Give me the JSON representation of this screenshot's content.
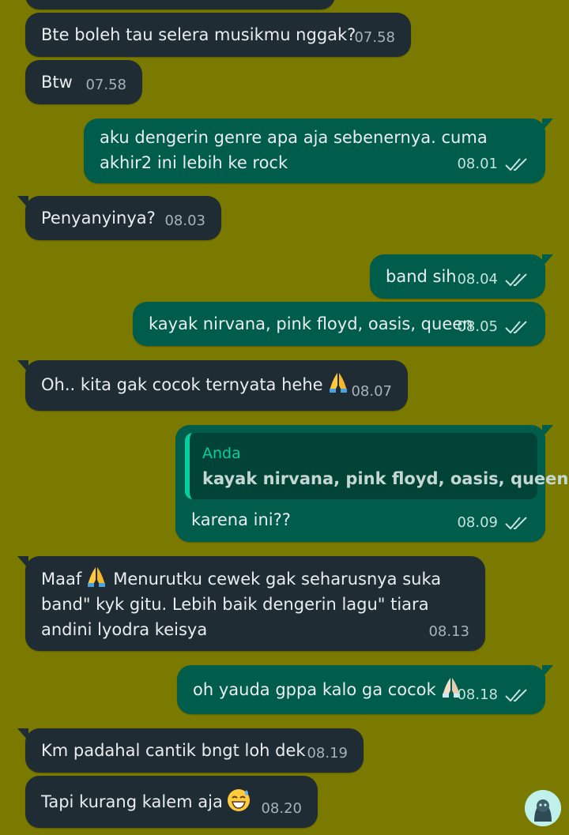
{
  "messages": [
    {
      "id": "m1",
      "dir": "in",
      "text": "Bte boleh tau selera musikmu nggak?",
      "time": "07.58"
    },
    {
      "id": "m2",
      "dir": "in",
      "text": "Btw",
      "time": "07.58"
    },
    {
      "id": "m3",
      "dir": "out",
      "text": "aku dengerin genre apa aja sebenernya. cuma akhir2 ini lebih ke rock",
      "time": "08.01",
      "status": "read"
    },
    {
      "id": "m4",
      "dir": "in",
      "text": "Penyanyinya?",
      "time": "08.03"
    },
    {
      "id": "m5",
      "dir": "out",
      "text": "band sih",
      "time": "08.04",
      "status": "read"
    },
    {
      "id": "m6",
      "dir": "out",
      "text": "kayak nirvana, pink floyd, oasis, queen",
      "time": "08.05",
      "status": "read"
    },
    {
      "id": "m7",
      "dir": "in",
      "text": "Oh.. kita gak cocok ternyata hehe",
      "emoji": "folded-hands",
      "time": "08.07"
    },
    {
      "id": "m8",
      "dir": "out",
      "quote_author": "Anda",
      "quote_text": "kayak nirvana, pink floyd, oasis, queen",
      "text": "karena ini??",
      "time": "08.09",
      "status": "read"
    },
    {
      "id": "m9",
      "dir": "in",
      "text_before": "Maaf",
      "emoji": "folded-hands",
      "text": "Menurutku cewek gak seharusnya suka band\" kyk gitu. Lebih baik dengerin lagu\" tiara andini lyodra keisya",
      "time": "08.13"
    },
    {
      "id": "m10",
      "dir": "out",
      "text": "oh yauda gppa kalo ga cocok",
      "emoji": "folded-hands-light",
      "time": "08.18",
      "status": "read"
    },
    {
      "id": "m11",
      "dir": "in",
      "text": "Km padahal cantik bngt loh dek",
      "time": "08.19"
    },
    {
      "id": "m12",
      "dir": "in",
      "text": "Tapi kurang kalem aja",
      "emoji": "grinning-face-with-sweat",
      "time": "08.20"
    }
  ],
  "icons": {
    "read_receipt": "double-check-icon",
    "avatar": "contact-avatar"
  },
  "colors": {
    "background": "#7a7a00",
    "incoming": "#1f2c34",
    "outgoing": "#005c4b",
    "quote_accent": "#06cf9c"
  }
}
